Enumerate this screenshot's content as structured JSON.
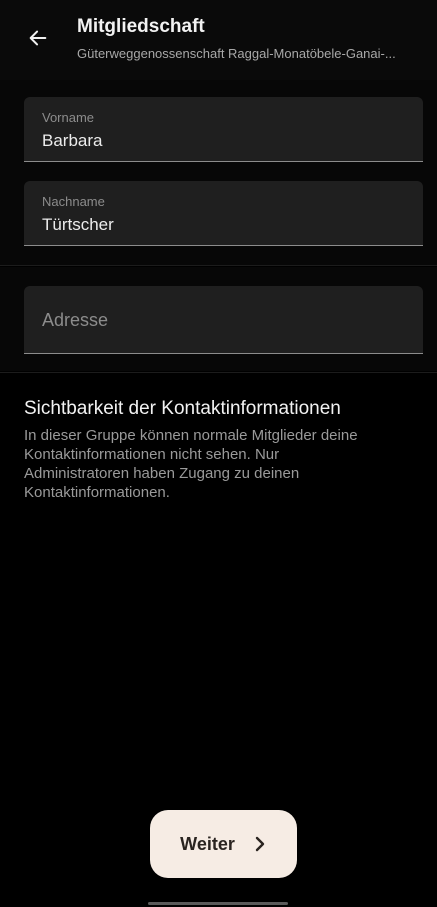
{
  "header": {
    "title": "Mitgliedschaft",
    "subtitle": "Güterweggenossenschaft Raggal-Monatöbele-Ganai-...",
    "back_icon": "arrow-left-icon"
  },
  "form": {
    "first_name": {
      "label": "Vorname",
      "value": "Barbara"
    },
    "last_name": {
      "label": "Nachname",
      "value": "Türtscher"
    },
    "address": {
      "placeholder": "Adresse",
      "value": ""
    }
  },
  "visibility": {
    "title": "Sichtbarkeit der Kontaktinformationen",
    "text": "In dieser Gruppe können normale Mitglieder deine Kontaktinformationen nicht sehen. Nur Administratoren haben Zugang zu deinen Kontaktinformationen."
  },
  "footer": {
    "next_label": "Weiter",
    "next_icon": "chevron-right-icon"
  },
  "colors": {
    "background": "#000000",
    "field_background": "#1f1f1f",
    "button_background": "#f6ece4",
    "muted_text": "#9a9a9a"
  }
}
